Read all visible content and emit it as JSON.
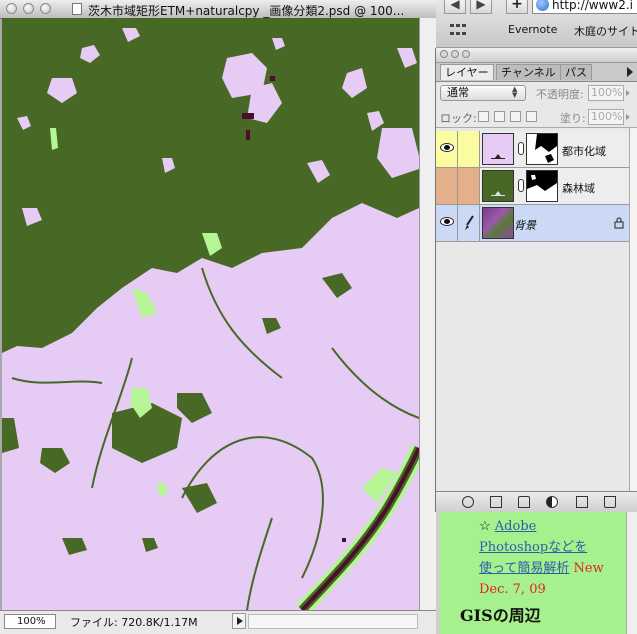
{
  "document": {
    "title": "茨木市域矩形ETM+naturalcpy _画像分類2.psd @ 100...",
    "zoom": "100%",
    "file_info": "ファイル: 720.8K/1.17M"
  },
  "browser": {
    "back": "◀",
    "forward": "▶",
    "add": "+",
    "url": "http://www2.i",
    "bookmarks": [
      "Evernote",
      "木庭のサイト"
    ]
  },
  "layers_palette": {
    "tabs": [
      "レイヤー",
      "チャンネル",
      "パス"
    ],
    "blend_mode": "通常",
    "opacity_label": "不透明度:",
    "opacity_value": "100%",
    "lock_label": "ロック:",
    "fill_label": "塗り:",
    "fill_value": "100%",
    "layers": [
      {
        "name": "都市化域",
        "color": "#e6ccf4",
        "row_color": "#fbfba0"
      },
      {
        "name": "森林域",
        "color": "#486826",
        "row_color": "#e4b08c"
      },
      {
        "name": "背景",
        "color": "#8a4a9e",
        "row_color": "#cbd9f7"
      }
    ]
  },
  "web_page": {
    "star": "☆",
    "link_line1": "Adobe",
    "link_line2": "Photoshopなどを",
    "link_line3": "使って簡易解析",
    "new_label": "New",
    "date": "Dec. 7, 09",
    "section_title": "GISの周辺"
  },
  "colors": {
    "urban": "#e6ccf4",
    "forest": "#486826",
    "river": "#4a0f2a",
    "light_green": "#b5f595"
  }
}
